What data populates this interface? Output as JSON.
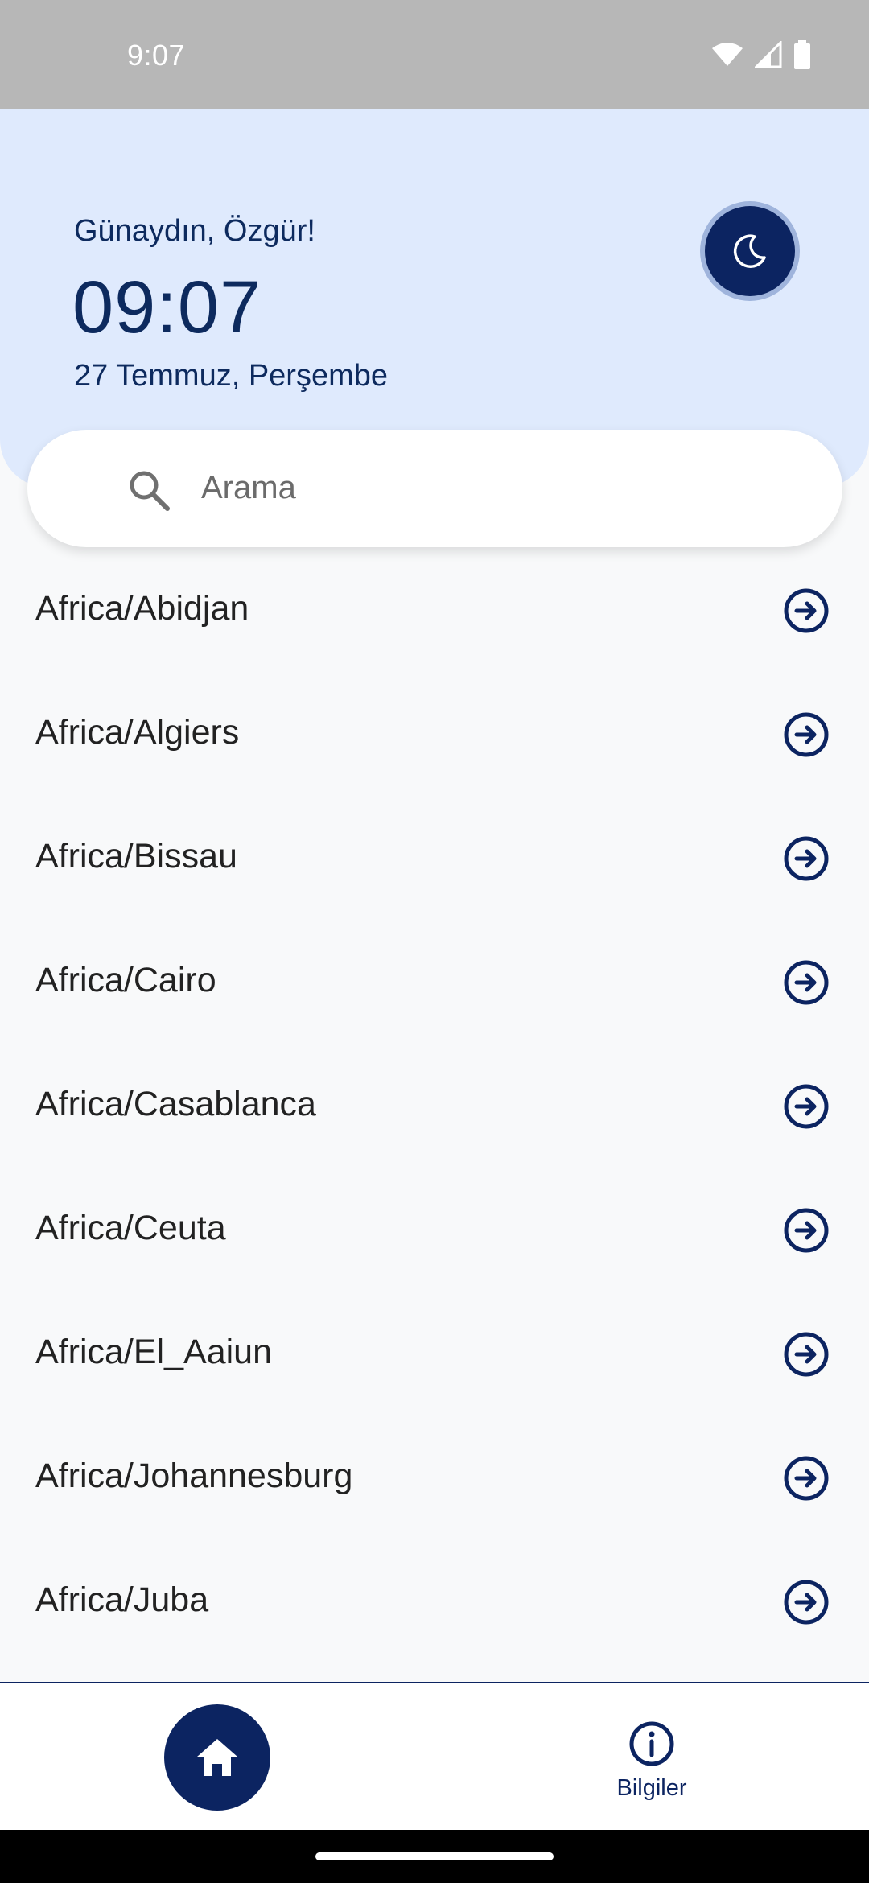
{
  "status_bar": {
    "time": "9:07"
  },
  "header": {
    "greeting": "Günaydın, Özgür!",
    "clock": "09:07",
    "date": "27 Temmuz, Perşembe",
    "theme_icon": "moon-icon"
  },
  "search": {
    "placeholder": "Arama",
    "value": ""
  },
  "timezones": [
    {
      "label": "Africa/Abidjan"
    },
    {
      "label": "Africa/Algiers"
    },
    {
      "label": "Africa/Bissau"
    },
    {
      "label": "Africa/Cairo"
    },
    {
      "label": "Africa/Casablanca"
    },
    {
      "label": "Africa/Ceuta"
    },
    {
      "label": "Africa/El_Aaiun"
    },
    {
      "label": "Africa/Johannesburg"
    },
    {
      "label": "Africa/Juba"
    }
  ],
  "bottom_nav": {
    "home_icon": "home-icon",
    "info_label": "Bilgiler",
    "info_icon": "info-icon"
  },
  "colors": {
    "primary": "#0c2461",
    "header_bg": "#dfeafd",
    "list_bg": "#f8f9fa"
  }
}
